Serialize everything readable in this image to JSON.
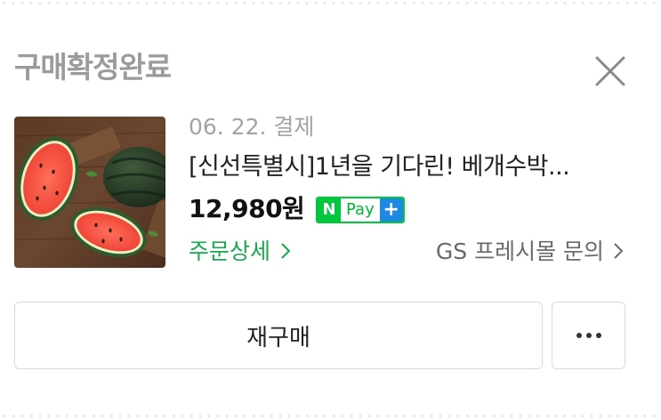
{
  "header": {
    "status_title": "구매확정완료",
    "close_icon": "close-icon"
  },
  "order": {
    "date": "06. 22. 결제",
    "product_name": "[신선특별시]1년을 기다린! 베개수박...",
    "price": "12,980원",
    "npay": {
      "n": "N",
      "pay": "Pay",
      "plus": "+"
    },
    "detail_link": "주문상세",
    "seller_inquiry": "GS 프레시몰 문의"
  },
  "actions": {
    "rebuy_label": "재구매",
    "more_icon": "more-horizontal-icon"
  },
  "colors": {
    "accent_green": "#1aa84d",
    "npay_green": "#00c73c",
    "npay_blue": "#1e88e5",
    "muted_text": "#9b9b9b"
  }
}
